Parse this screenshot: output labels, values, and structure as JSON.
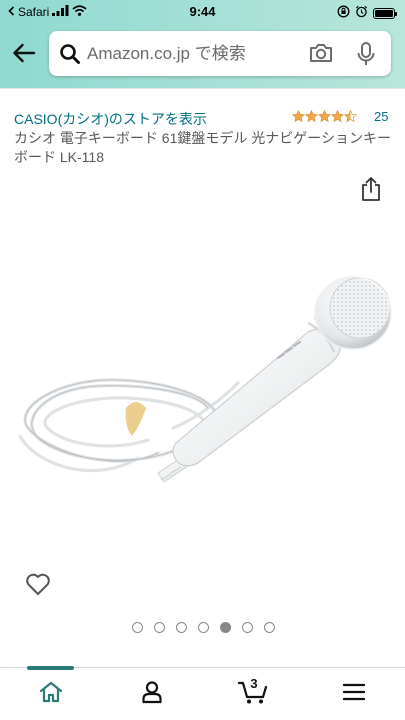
{
  "status_bar": {
    "carrier": "Safari",
    "time": "9:44"
  },
  "header": {
    "search_placeholder": "Amazon.co.jp で検索"
  },
  "product": {
    "store_link": "CASIO(カシオ)のストアを表示",
    "rating_stars": 4.5,
    "review_count": "25",
    "title": "カシオ 電子キーボード 61鍵盤モデル 光ナビゲーションキーボード LK-118"
  },
  "carousel": {
    "image_count": 7,
    "active_index": 4
  },
  "bottom_nav": {
    "cart_count": "3",
    "active_tab": "home"
  },
  "colors": {
    "header_gradient": "#a6e0d6",
    "link": "#007185",
    "star": "#f3a847",
    "text_secondary": "#565959",
    "active_tab_indicator": "#2b7a78"
  }
}
